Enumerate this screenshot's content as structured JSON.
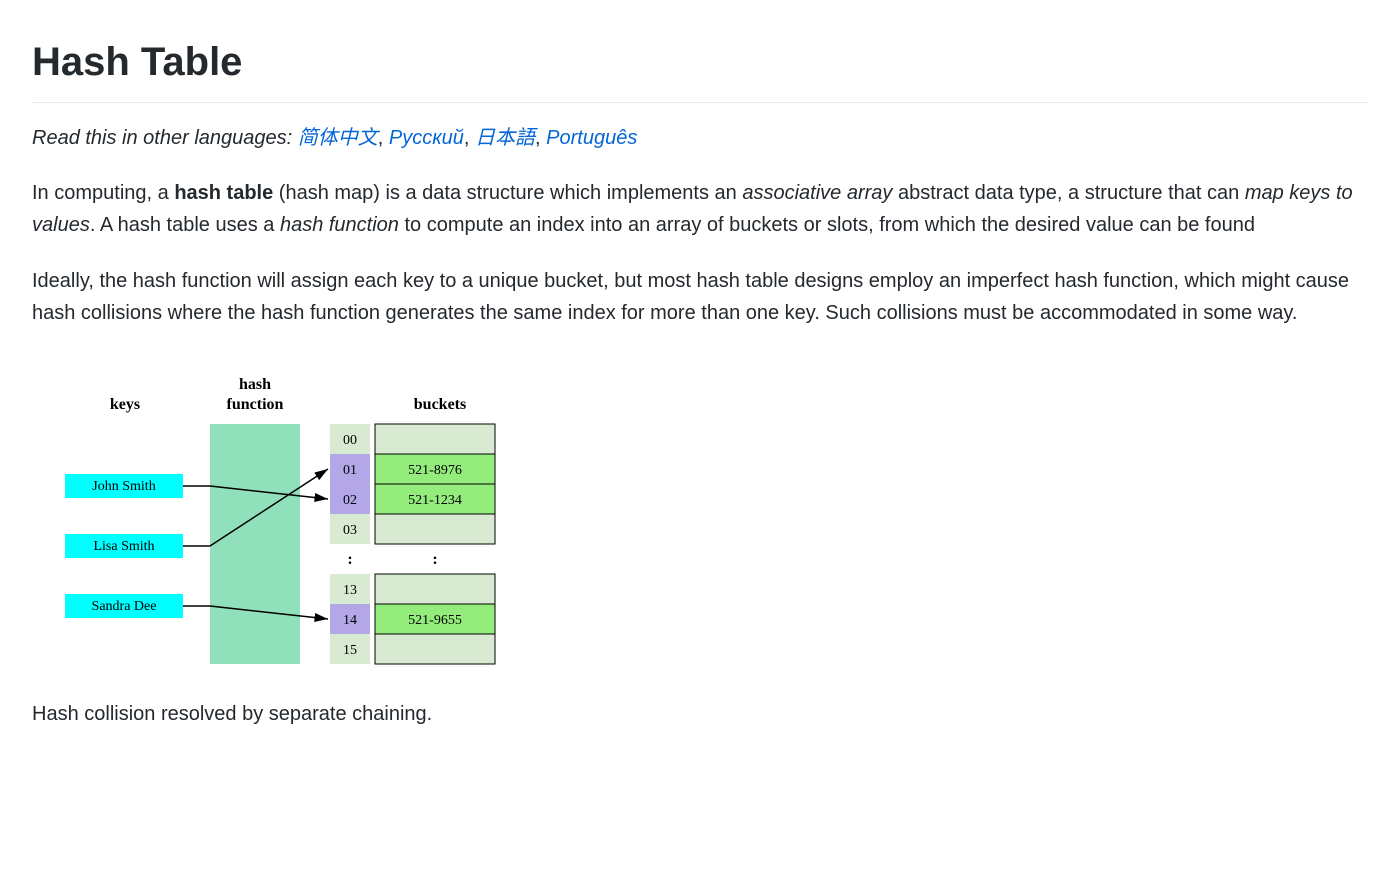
{
  "title": "Hash Table",
  "langs": {
    "prefix": "Read this in other languages:",
    "items": [
      "简体中文",
      "Русский",
      "日本語",
      "Português"
    ]
  },
  "para1": {
    "t1": "In computing, a ",
    "bold1": "hash table",
    "t2": " (hash map) is a data structure which implements an ",
    "ital1": "associative array",
    "t3": " abstract data type, a structure that can ",
    "ital2": "map keys to values",
    "t4": ". A hash table uses a ",
    "ital3": "hash function",
    "t5": " to compute an index into an array of buckets or slots, from which the desired value can be found"
  },
  "para2": "Ideally, the hash function will assign each key to a unique bucket, but most hash table designs employ an imperfect hash function, which might cause hash collisions where the hash function generates the same index for more than one key. Such collisions must be accommodated in some way.",
  "diagram": {
    "headers": {
      "keys": "keys",
      "hashfn": "hash\nfunction",
      "buckets": "buckets"
    },
    "keys": [
      "John Smith",
      "Lisa Smith",
      "Sandra Dee"
    ],
    "indices_top": [
      "00",
      "01",
      "02",
      "03"
    ],
    "dots": ":",
    "indices_bottom": [
      "13",
      "14",
      "15"
    ],
    "bucket_values": {
      "01": "521-8976",
      "02": "521-1234",
      "14": "521-9655"
    }
  },
  "caption": "Hash collision resolved by separate chaining."
}
